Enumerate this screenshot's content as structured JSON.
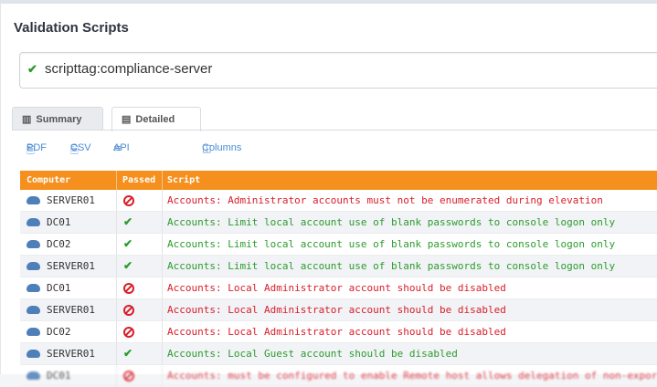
{
  "section": {
    "title": "Validation Scripts"
  },
  "search": {
    "value": "scripttag:compliance-server"
  },
  "tabs": [
    {
      "label": "Summary",
      "icon": "bar-chart-icon"
    },
    {
      "label": "Detailed",
      "icon": "table-icon"
    }
  ],
  "toolbar": {
    "pdf": "PDF",
    "csv": "CSV",
    "api": "API",
    "columns": "Columns"
  },
  "table": {
    "headers": {
      "computer": "Computer",
      "passed": "Passed",
      "script": "Script"
    },
    "rows": [
      {
        "computer": "SERVER01",
        "passed": false,
        "script": "Accounts: Administrator accounts must not be enumerated during elevation"
      },
      {
        "computer": "DC01",
        "passed": true,
        "script": "Accounts: Limit local account use of blank passwords to console logon only"
      },
      {
        "computer": "DC02",
        "passed": true,
        "script": "Accounts: Limit local account use of blank passwords to console logon only"
      },
      {
        "computer": "SERVER01",
        "passed": true,
        "script": "Accounts: Limit local account use of blank passwords to console logon only"
      },
      {
        "computer": "DC01",
        "passed": false,
        "script": "Accounts: Local Administrator account should be disabled"
      },
      {
        "computer": "SERVER01",
        "passed": false,
        "script": "Accounts: Local Administrator account should be disabled"
      },
      {
        "computer": "DC02",
        "passed": false,
        "script": "Accounts: Local Administrator account should be disabled"
      },
      {
        "computer": "SERVER01",
        "passed": true,
        "script": "Accounts: Local Guest account should be disabled"
      },
      {
        "computer": "DC01",
        "passed": false,
        "script": "Accounts: must be configured to enable Remote host allows delegation of non-export"
      }
    ]
  },
  "colors": {
    "header": "#f5901f",
    "fail": "#d91e2a",
    "pass": "#2c9c2c",
    "link": "#4a8bd6"
  }
}
